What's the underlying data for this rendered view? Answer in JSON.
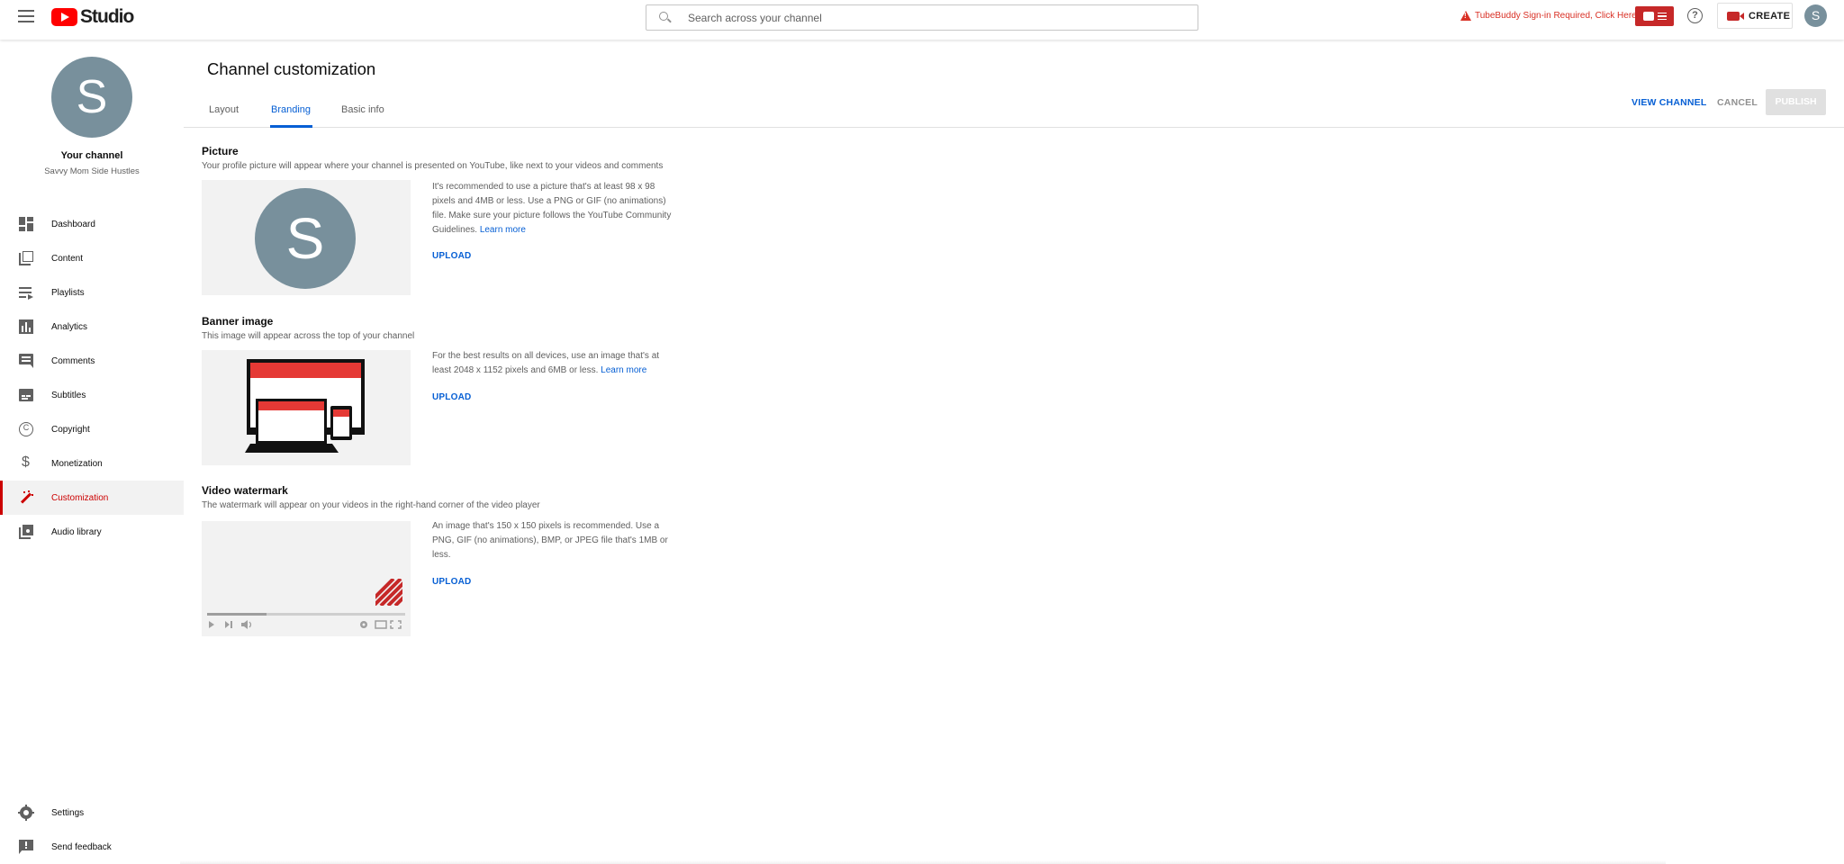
{
  "topbar": {
    "logo_text": "Studio",
    "search_placeholder": "Search across your channel",
    "warning_text": "TubeBuddy Sign-in Required, Click Here",
    "create_label": "CREATE",
    "avatar_letter": "S",
    "help_symbol": "?"
  },
  "sidebar": {
    "avatar_letter": "S",
    "your_channel": "Your channel",
    "channel_name": "Savvy Mom Side Hustles",
    "items": [
      {
        "label": "Dashboard",
        "icon": "dashboard-icon"
      },
      {
        "label": "Content",
        "icon": "content-icon"
      },
      {
        "label": "Playlists",
        "icon": "playlists-icon"
      },
      {
        "label": "Analytics",
        "icon": "analytics-icon"
      },
      {
        "label": "Comments",
        "icon": "comments-icon"
      },
      {
        "label": "Subtitles",
        "icon": "subtitles-icon"
      },
      {
        "label": "Copyright",
        "icon": "copyright-icon"
      },
      {
        "label": "Monetization",
        "icon": "monetization-icon"
      },
      {
        "label": "Customization",
        "icon": "customization-icon",
        "active": true
      },
      {
        "label": "Audio library",
        "icon": "audio-library-icon"
      }
    ],
    "bottom_items": [
      {
        "label": "Settings",
        "icon": "settings-icon"
      },
      {
        "label": "Send feedback",
        "icon": "feedback-icon"
      }
    ]
  },
  "main": {
    "title": "Channel customization",
    "tabs": [
      {
        "label": "Layout"
      },
      {
        "label": "Branding",
        "active": true
      },
      {
        "label": "Basic info"
      }
    ],
    "actions": {
      "view_channel": "VIEW CHANNEL",
      "cancel": "CANCEL",
      "publish": "PUBLISH"
    },
    "sections": {
      "picture": {
        "title": "Picture",
        "description": "Your profile picture will appear where your channel is presented on YouTube, like next to your videos and comments",
        "avatar_letter": "S",
        "help": "It's recommended to use a picture that's at least 98 x 98 pixels and 4MB or less. Use a PNG or GIF (no animations) file. Make sure your picture follows the YouTube Community Guidelines.",
        "learn_more": "Learn more",
        "upload": "UPLOAD"
      },
      "banner": {
        "title": "Banner image",
        "description": "This image will appear across the top of your channel",
        "help": "For the best results on all devices, use an image that's at least 2048 x 1152 pixels and 6MB or less.",
        "learn_more": "Learn more",
        "upload": "UPLOAD"
      },
      "watermark": {
        "title": "Video watermark",
        "description": "The watermark will appear on your videos in the right-hand corner of the video player",
        "help": "An image that's 150 x 150 pixels is recommended. Use a PNG, GIF (no animations), BMP, or JPEG file that's 1MB or less.",
        "upload": "UPLOAD"
      }
    }
  },
  "colors": {
    "accent_blue": "#065fd4",
    "brand_red": "#ff0000",
    "active_red": "#cc0000",
    "avatar_gray": "#78909c"
  }
}
